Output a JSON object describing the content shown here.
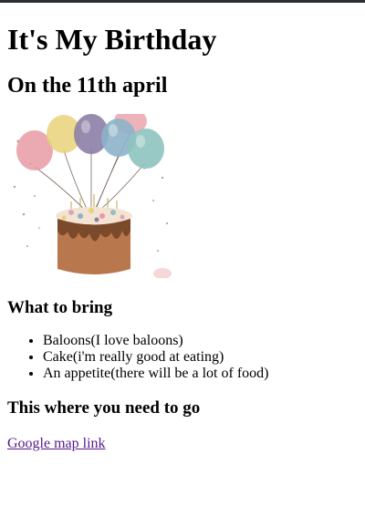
{
  "page": {
    "title": "It's My Birthday",
    "date_heading": "On the 11th april",
    "image": {
      "subject": "watercolor birthday cake with balloons",
      "colors": {
        "balloon_pink": "#e89aa3",
        "balloon_yellow": "#e9d27a",
        "balloon_purple": "#8c7fa6",
        "balloon_blue": "#8cb3c9",
        "balloon_teal": "#8ec3bf",
        "cake_brown": "#b9774d",
        "cake_drip": "#7a4a2b",
        "sprinkles": "#d9a8b6"
      }
    },
    "bring_heading": "What to bring",
    "bring_items": [
      "Baloons(I love baloons)",
      "Cake(i'm really good at eating)",
      "An appetite(there will be a lot of food)"
    ],
    "location_heading": "This where you need to go",
    "map_link": "Google map link"
  }
}
